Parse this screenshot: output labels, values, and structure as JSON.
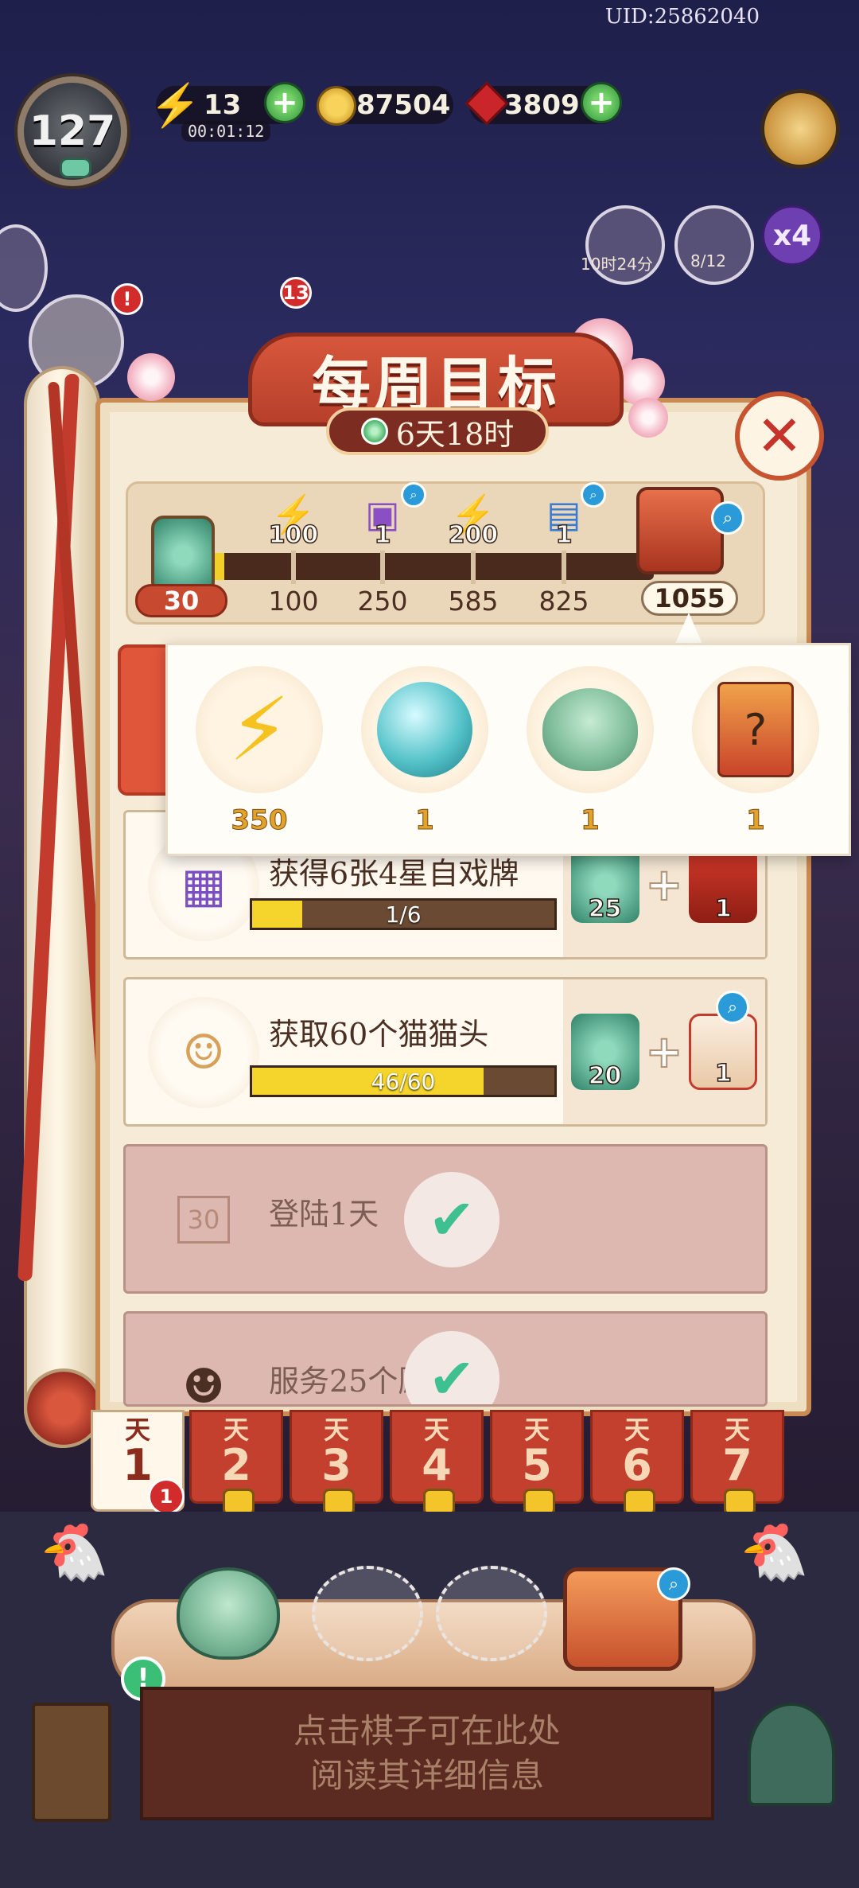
{
  "hud": {
    "uid": "UID:25862040",
    "level": "127",
    "energy": "13",
    "energy_timer": "00:01:12",
    "coins": "87504",
    "gems": "3809",
    "timer_a": "10时24分",
    "timer_b": "8/12",
    "multiplier": "x4",
    "badge_13": "13"
  },
  "weekly": {
    "title": "每周目标",
    "time_left": "6天18时",
    "current_points": "30",
    "milestones": [
      {
        "reward_count": "100",
        "reward_icon": "bolt-icon",
        "points": "100"
      },
      {
        "reward_count": "1",
        "reward_icon": "gift-pack-icon",
        "points": "250"
      },
      {
        "reward_count": "200",
        "reward_icon": "bolt-icon",
        "points": "585"
      },
      {
        "reward_count": "1",
        "reward_icon": "mystery-chest-icon",
        "points": "825"
      }
    ],
    "final_points": "1055",
    "progress_fraction": 0.02
  },
  "tooltip": {
    "items": [
      {
        "icon": "bolt-icon",
        "count": "350"
      },
      {
        "icon": "jade-orb-icon",
        "count": "1"
      },
      {
        "icon": "jade-cat-icon",
        "count": "1"
      },
      {
        "icon": "mystery-cards-icon",
        "count": "1"
      }
    ]
  },
  "tasks": [
    {
      "title": "获得6张4星自戏牌",
      "progress": "1/6",
      "fraction": 0.1667,
      "rewards": [
        {
          "icon": "jade-medal-icon",
          "count": "25"
        },
        {
          "icon": "red-gift-box-icon",
          "count": "1"
        }
      ]
    },
    {
      "title": "获取60个猫猫头",
      "progress": "46/60",
      "fraction": 0.7667,
      "rewards": [
        {
          "icon": "jade-medal-icon",
          "count": "20"
        },
        {
          "icon": "silver-ticket-icon",
          "count": "1"
        }
      ]
    },
    {
      "title": "登陆1天",
      "calendar": "30",
      "done": true
    },
    {
      "title": "服务25个顾客",
      "done": true
    }
  ],
  "days": {
    "label": "天",
    "numbers": [
      "1",
      "2",
      "3",
      "4",
      "5",
      "6",
      "7"
    ],
    "active_badge": "1"
  },
  "info": {
    "line1": "点击棋子可在此处",
    "line2": "阅读其详细信息"
  },
  "colors": {
    "accent_red": "#c2402d",
    "progress_yellow": "#f5d52c",
    "check_green": "#3fc091",
    "panel_bg": "#f6ebd7"
  }
}
